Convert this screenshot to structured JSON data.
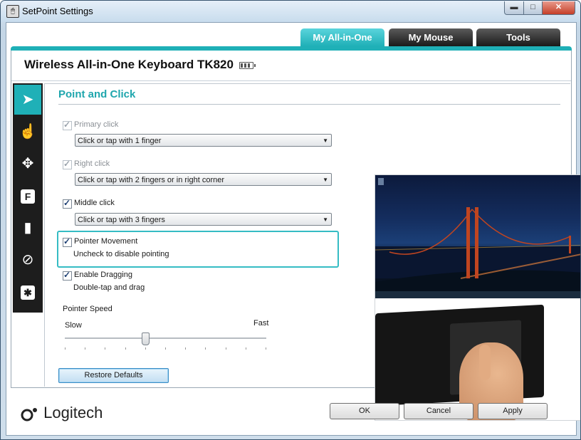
{
  "window": {
    "title": "SetPoint Settings",
    "controls": {
      "minimize": "▬",
      "maximize": "□",
      "close": "✕"
    }
  },
  "tabs": [
    {
      "label": "My All-in-One",
      "active": true
    },
    {
      "label": "My Mouse",
      "active": false
    },
    {
      "label": "Tools",
      "active": false
    }
  ],
  "device": {
    "name": "Wireless All-in-One Keyboard TK820"
  },
  "sidebar": {
    "items": [
      {
        "icon": "pointer-icon",
        "glyph": "➤",
        "active": true
      },
      {
        "icon": "hand-icon",
        "glyph": "☝",
        "active": false
      },
      {
        "icon": "move-icon",
        "glyph": "✥",
        "active": false
      },
      {
        "icon": "f-key-icon",
        "glyph": "F",
        "active": false
      },
      {
        "icon": "battery-icon",
        "glyph": "▮",
        "active": false
      },
      {
        "icon": "disable-icon",
        "glyph": "⊘",
        "active": false
      },
      {
        "icon": "asterisk-icon",
        "glyph": "✱",
        "active": false
      }
    ]
  },
  "section": {
    "title": "Point and Click"
  },
  "options": {
    "primary": {
      "label": "Primary click",
      "checked": true,
      "enabled": false,
      "select": "Click or tap with 1 finger"
    },
    "right": {
      "label": "Right click",
      "checked": true,
      "enabled": false,
      "select": "Click or tap with 2 fingers or in right corner"
    },
    "middle": {
      "label": "Middle click",
      "checked": true,
      "enabled": true,
      "select": "Click or tap with 3 fingers"
    },
    "pointer": {
      "label": "Pointer Movement",
      "checked": true,
      "desc": "Uncheck to disable pointing"
    },
    "dragging": {
      "label": "Enable Dragging",
      "checked": true,
      "desc": "Double-tap and drag"
    }
  },
  "speed": {
    "label": "Pointer Speed",
    "min_label": "Slow",
    "max_label": "Fast",
    "value": 0.4,
    "ticks": 11
  },
  "restore_label": "Restore Defaults",
  "logo_text": "Logitech",
  "buttons": {
    "ok": "OK",
    "cancel": "Cancel",
    "apply": "Apply"
  },
  "colors": {
    "accent": "#1fb0b7",
    "sidebar": "#1d1d1d",
    "tab_dark": "#2a2a2a"
  }
}
